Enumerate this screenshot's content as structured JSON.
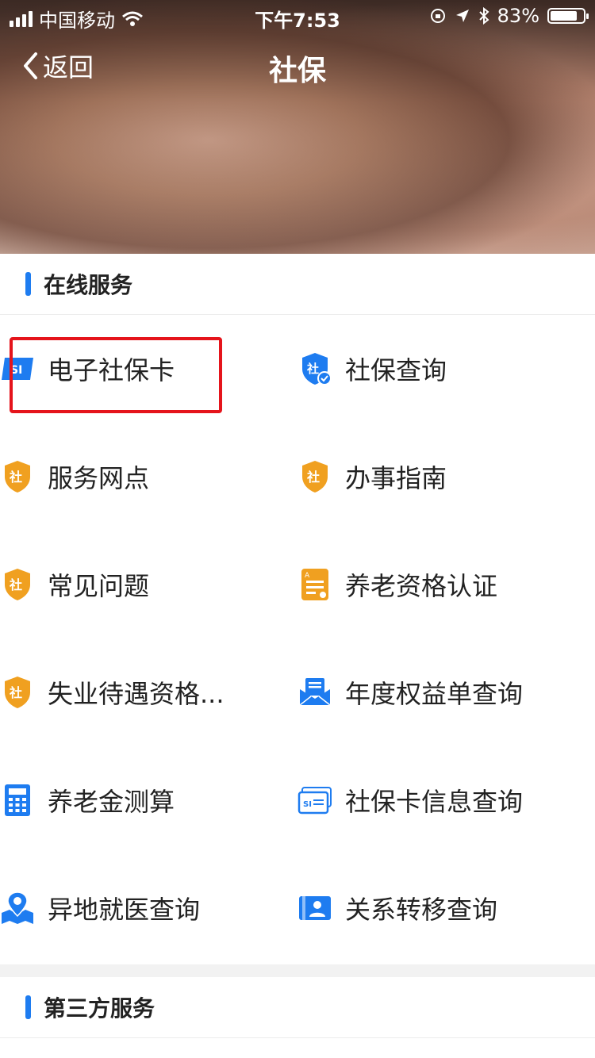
{
  "status_bar": {
    "carrier": "中国移动",
    "time": "下午7:53",
    "battery_text": "83%",
    "battery_level": 0.83
  },
  "nav": {
    "back_label": "返回",
    "title": "社保"
  },
  "online_services": {
    "title": "在线服务",
    "items": [
      {
        "label": "电子社保卡",
        "icon": "si-card-icon"
      },
      {
        "label": "社保查询",
        "icon": "shield-check-icon"
      },
      {
        "label": "服务网点",
        "icon": "shield-she-icon"
      },
      {
        "label": "办事指南",
        "icon": "shield-she-icon"
      },
      {
        "label": "常见问题",
        "icon": "shield-she-icon"
      },
      {
        "label": "养老资格认证",
        "icon": "certificate-icon"
      },
      {
        "label": "失业待遇资格...",
        "icon": "shield-she-icon"
      },
      {
        "label": "年度权益单查询",
        "icon": "envelope-icon"
      },
      {
        "label": "养老金测算",
        "icon": "calculator-icon"
      },
      {
        "label": "社保卡信息查询",
        "icon": "si-card-outline-icon"
      },
      {
        "label": "异地就医查询",
        "icon": "map-pin-icon"
      },
      {
        "label": "关系转移查询",
        "icon": "contact-card-icon"
      }
    ]
  },
  "third_party": {
    "title": "第三方服务"
  },
  "colors": {
    "accent": "#1e7cf0",
    "shield_orange": "#f0a020",
    "highlight_red": "#e5141b"
  }
}
